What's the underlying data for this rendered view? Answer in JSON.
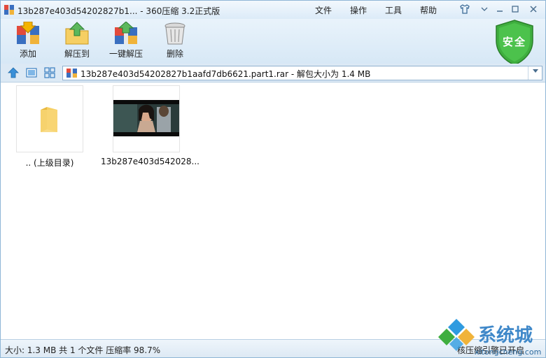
{
  "window": {
    "title": "13b287e403d54202827b1... - 360压缩 3.2正式版",
    "menus": [
      "文件",
      "操作",
      "工具",
      "帮助"
    ]
  },
  "toolbar": {
    "items": [
      {
        "label": "添加",
        "icon": "add-archive-icon"
      },
      {
        "label": "解压到",
        "icon": "extract-to-icon"
      },
      {
        "label": "一键解压",
        "icon": "one-click-extract-icon"
      },
      {
        "label": "删除",
        "icon": "trash-icon"
      }
    ],
    "security_badge": "安全"
  },
  "address": {
    "path": "13b287e403d54202827b1aafd7db6621.part1.rar - 解包大小为 1.4 MB"
  },
  "files": [
    {
      "name": ".. (上级目录)",
      "type": "folder"
    },
    {
      "name": "13b287e403d542028...",
      "type": "video"
    }
  ],
  "status": {
    "left": "大小: 1.3 MB 共 1 个文件 压缩率 98.7%",
    "right": "核压缩引擎已开启"
  },
  "watermark": {
    "brand": "系统城",
    "url": "xitongcheng.com"
  },
  "colors": {
    "accent": "#3f88c9",
    "shield": "#3fae3f",
    "folder": "#f6cf63"
  }
}
